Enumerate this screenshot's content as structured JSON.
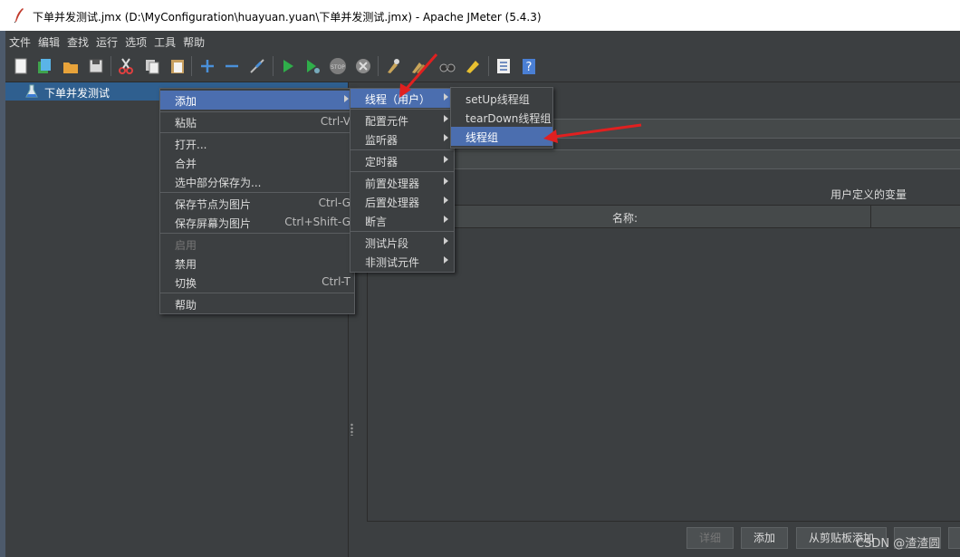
{
  "window": {
    "title": "下单并发测试.jmx (D:\\MyConfiguration\\huayuan.yuan\\下单并发测试.jmx) - Apache JMeter (5.4.3)"
  },
  "menubar": [
    "文件",
    "编辑",
    "查找",
    "运行",
    "选项",
    "工具",
    "帮助"
  ],
  "toolbar": {
    "icons": [
      "new-icon",
      "templates-icon",
      "open-icon",
      "save-icon",
      "cut-icon",
      "copy-icon",
      "paste-icon",
      "expand-icon",
      "collapse-icon",
      "toggle-icon",
      "start-icon",
      "start-no-pause-icon",
      "stop-icon",
      "shutdown-icon",
      "clear-icon",
      "clear-all-icon",
      "search-icon",
      "reset-search-icon",
      "function-helper-icon",
      "help-icon"
    ]
  },
  "tree": {
    "root_label": "下单并发测试"
  },
  "context_menu": {
    "items": [
      {
        "label": "添加",
        "shortcut": "",
        "submenu": true
      },
      {
        "label": "粘贴",
        "shortcut": "Ctrl-V"
      },
      {
        "label": "打开...",
        "shortcut": ""
      },
      {
        "label": "合并",
        "shortcut": ""
      },
      {
        "label": "选中部分保存为...",
        "shortcut": ""
      },
      {
        "label": "保存节点为图片",
        "shortcut": "Ctrl-G"
      },
      {
        "label": "保存屏幕为图片",
        "shortcut": "Ctrl+Shift-G"
      },
      {
        "label": "启用",
        "shortcut": "",
        "disabled": true
      },
      {
        "label": "禁用",
        "shortcut": ""
      },
      {
        "label": "切换",
        "shortcut": "Ctrl-T"
      },
      {
        "label": "帮助",
        "shortcut": ""
      }
    ]
  },
  "add_submenu": {
    "items": [
      "线程（用户）",
      "配置元件",
      "监听器",
      "定时器",
      "前置处理器",
      "后置处理器",
      "断言",
      "测试片段",
      "非测试元件"
    ]
  },
  "thread_submenu": {
    "items": [
      "setUp线程组",
      "tearDown线程组",
      "线程组"
    ]
  },
  "panel": {
    "vars_title": "用户定义的变量",
    "name_column": "名称:",
    "buttons": [
      "详细",
      "添加",
      "从剪贴板添加"
    ]
  },
  "watermark": "CSDN @渣渣圆",
  "colors": {
    "selection": "#4b6eaf",
    "tree_selection": "#2f5f8f",
    "annotation_arrow": "#e02020"
  }
}
